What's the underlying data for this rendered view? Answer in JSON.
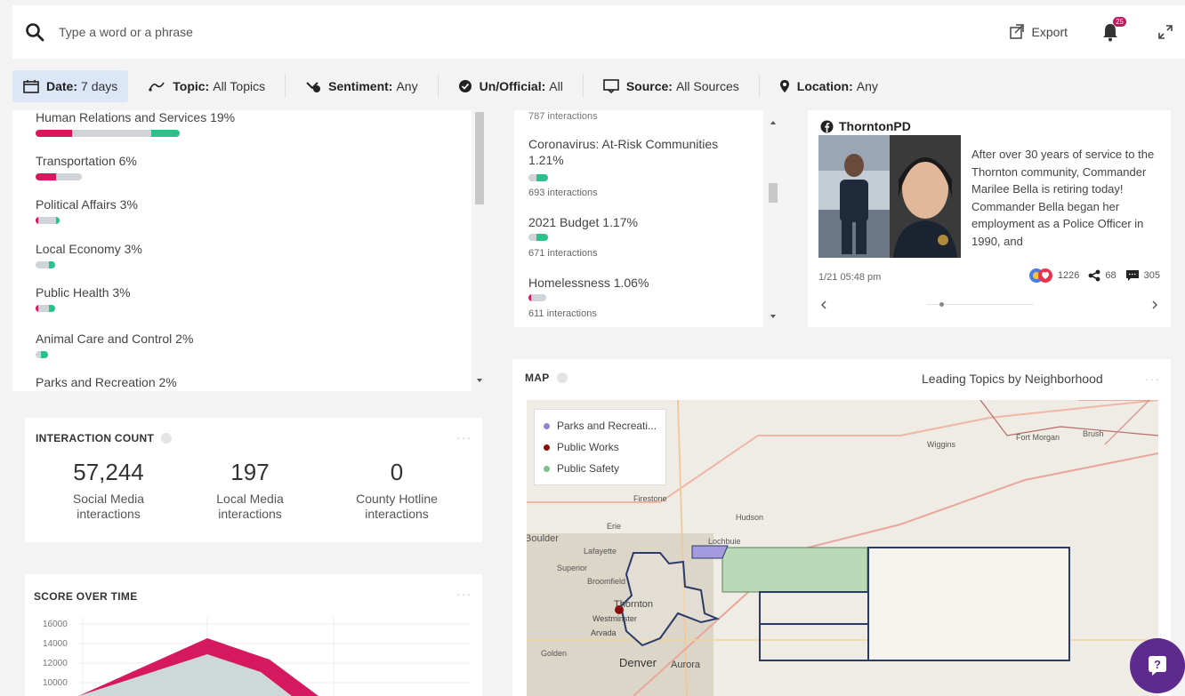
{
  "search": {
    "placeholder": "Type a word or a phrase"
  },
  "header": {
    "export_label": "Export",
    "notification_count": "25"
  },
  "filters": [
    {
      "key": "Date:",
      "value": "7 days"
    },
    {
      "key": "Topic:",
      "value": "All Topics"
    },
    {
      "key": "Sentiment:",
      "value": "Any"
    },
    {
      "key": "Un/Official:",
      "value": "All"
    },
    {
      "key": "Source:",
      "value": "All Sources"
    },
    {
      "key": "Location:",
      "value": "Any"
    }
  ],
  "topics": [
    {
      "label": "Human Relations and Services 19%",
      "neg": 0.25,
      "neu": 0.55,
      "pos": 0.2
    },
    {
      "label": "Transportation 6%",
      "neg": 0.45,
      "neu": 0.55,
      "pos": 0
    },
    {
      "label": "Political Affairs 3%",
      "neg": 0.1,
      "neu": 0.75,
      "pos": 0.15
    },
    {
      "label": "Local Economy 3%",
      "neg": 0,
      "neu": 0.7,
      "pos": 0.3
    },
    {
      "label": "Public Health 3%",
      "neg": 0.15,
      "neu": 0.55,
      "pos": 0.3
    },
    {
      "label": "Animal Care and Control 2%",
      "neg": 0,
      "neu": 0.45,
      "pos": 0.55
    },
    {
      "label": "Parks and Recreation 2%",
      "neg": 0,
      "neu": 0,
      "pos": 0
    }
  ],
  "middle_list": {
    "top_partial": "787 interactions",
    "items": [
      {
        "title_line1": "Coronavirus: At-Risk Communities",
        "title_line2": "1.21%",
        "interactions": "693 interactions"
      },
      {
        "title_line1": "2021 Budget 1.17%",
        "title_line2": "",
        "interactions": "671 interactions"
      },
      {
        "title_line1": "Homelessness 1.06%",
        "title_line2": "",
        "interactions": "611 interactions"
      }
    ]
  },
  "post": {
    "author": "ThorntonPD",
    "text": "After over 30 years of service to the Thornton community, Commander Marilee Bella is retiring today! Commander Bella began her employment as a Police Officer in 1990, and",
    "time": "1/21 05:48 pm",
    "reactions": "1226",
    "shares": "68",
    "comments": "305"
  },
  "interaction_count": {
    "title": "INTERACTION COUNT",
    "metrics": [
      {
        "value": "57,244",
        "label1": "Social Media",
        "label2": "interactions"
      },
      {
        "value": "197",
        "label1": "Local Media",
        "label2": "interactions"
      },
      {
        "value": "0",
        "label1": "County Hotline",
        "label2": "interactions"
      }
    ]
  },
  "map": {
    "title": "MAP",
    "dropdown": "Leading Topics by Neighborhood",
    "legend": [
      {
        "label": "Parks and Recreati...",
        "color": "#8d84d4"
      },
      {
        "label": "Public Works",
        "color": "#8b0e0e"
      },
      {
        "label": "Public Safety",
        "color": "#7fbf8f"
      }
    ],
    "places": [
      "Wiggins",
      "Fort Morgan",
      "Brush",
      "Firestone",
      "Hudson",
      "Erie",
      "Boulder",
      "Lafayette",
      "Lochbuie",
      "Superior",
      "Broomfield",
      "Thornton",
      "Westminster",
      "Arvada",
      "Golden",
      "Denver",
      "Aurora"
    ]
  },
  "score": {
    "title": "SCORE OVER TIME",
    "ticks": [
      "16000",
      "14000",
      "12000",
      "10000"
    ]
  },
  "colors": {
    "negative": "#d6185e",
    "neutral": "#d0d4d8",
    "positive": "#29c28a",
    "accent": "#5d2a8e"
  }
}
